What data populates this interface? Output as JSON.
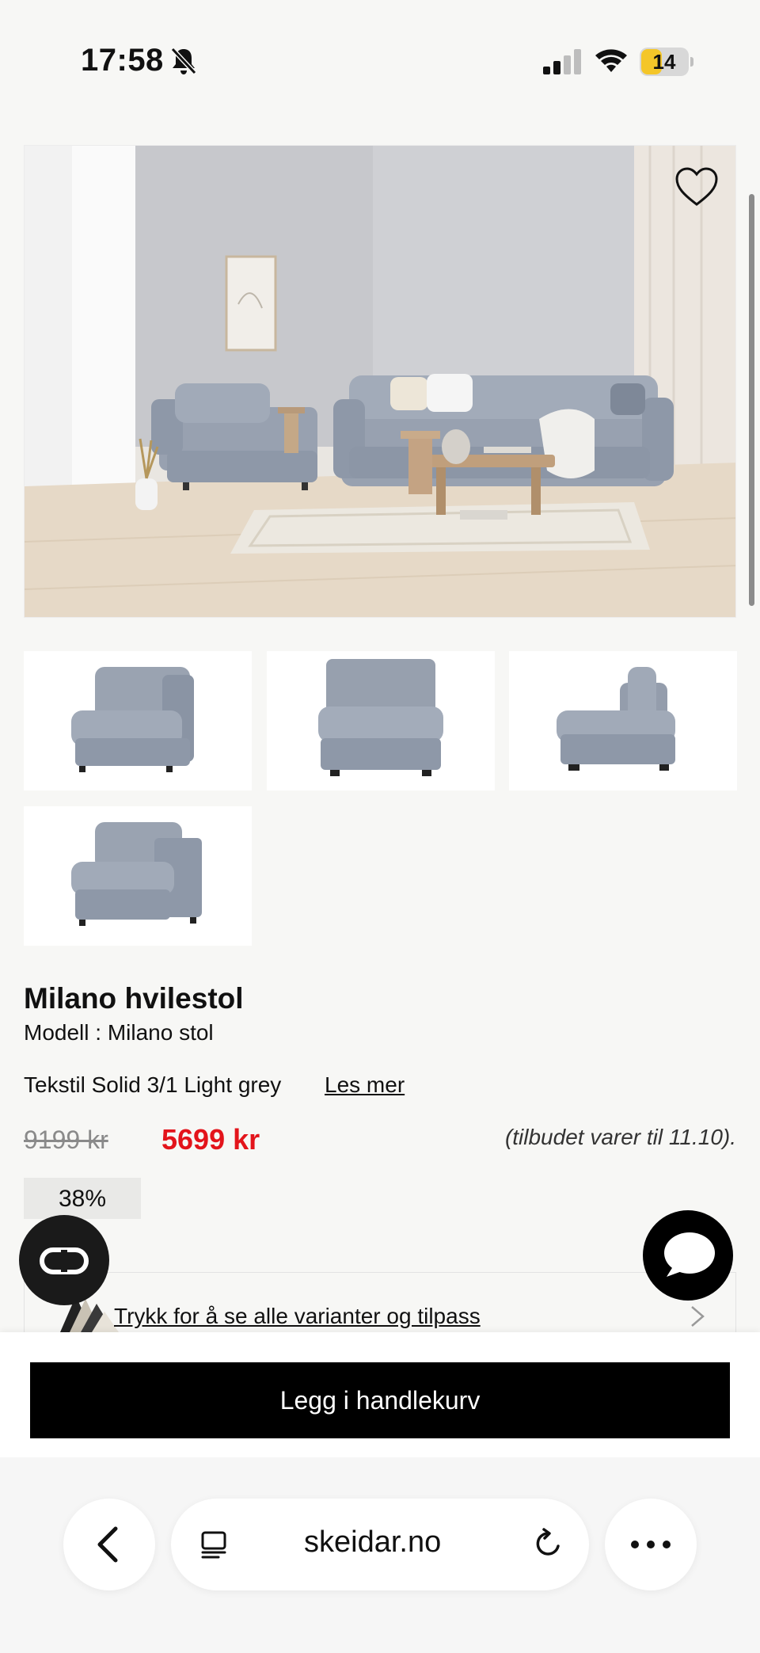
{
  "status_bar": {
    "time": "17:58",
    "battery_level": "14",
    "battery_fraction": 0.14,
    "icons": [
      "bell-off-icon",
      "signal-icon",
      "wifi-icon",
      "battery-icon"
    ]
  },
  "product": {
    "title": "Milano hvilestol",
    "model": "Modell : Milano stol",
    "variant": "Tekstil Solid 3/1 Light grey",
    "read_more": "Les mer",
    "old_price": "9199 kr",
    "new_price": "5699 kr",
    "offer_note": "(tilbudet varer til 11.10).",
    "discount": "38%",
    "variants_link": "Trykk for å se alle varianter og tilpass"
  },
  "actions": {
    "add_to_cart": "Legg i handlekurv"
  },
  "browser": {
    "url": "skeidar.no"
  },
  "colors": {
    "price_red": "#e3141b",
    "background": "#f7f7f5",
    "sofa_grey": "#8e98a8",
    "battery_yellow": "#f4c629"
  }
}
